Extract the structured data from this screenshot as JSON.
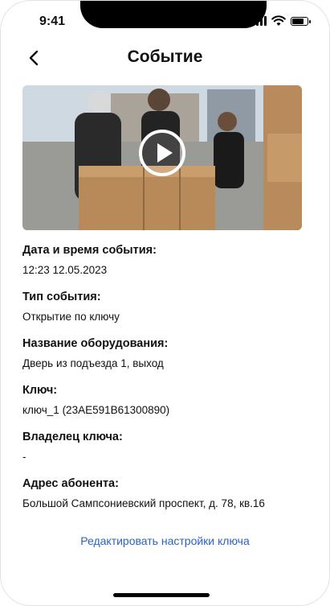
{
  "status_bar": {
    "time": "9:41"
  },
  "header": {
    "title": "Событие"
  },
  "video": {
    "icon": "play-icon"
  },
  "fields": [
    {
      "label": "Дата и время события:",
      "value": "12:23 12.05.2023"
    },
    {
      "label": "Тип события:",
      "value": "Открытие по ключу"
    },
    {
      "label": "Название оборудования:",
      "value": "Дверь из подъезда 1, выход"
    },
    {
      "label": "Ключ:",
      "value": "ключ_1 (23AE591B61300890)"
    },
    {
      "label": "Владелец ключа:",
      "value": "-"
    },
    {
      "label": "Адрес абонента:",
      "value": "Большой Сампсониевский проспект, д. 78, кв.16"
    }
  ],
  "actions": {
    "edit_key_settings": "Редактировать настройки ключа"
  },
  "colors": {
    "link": "#2a5fd6"
  }
}
